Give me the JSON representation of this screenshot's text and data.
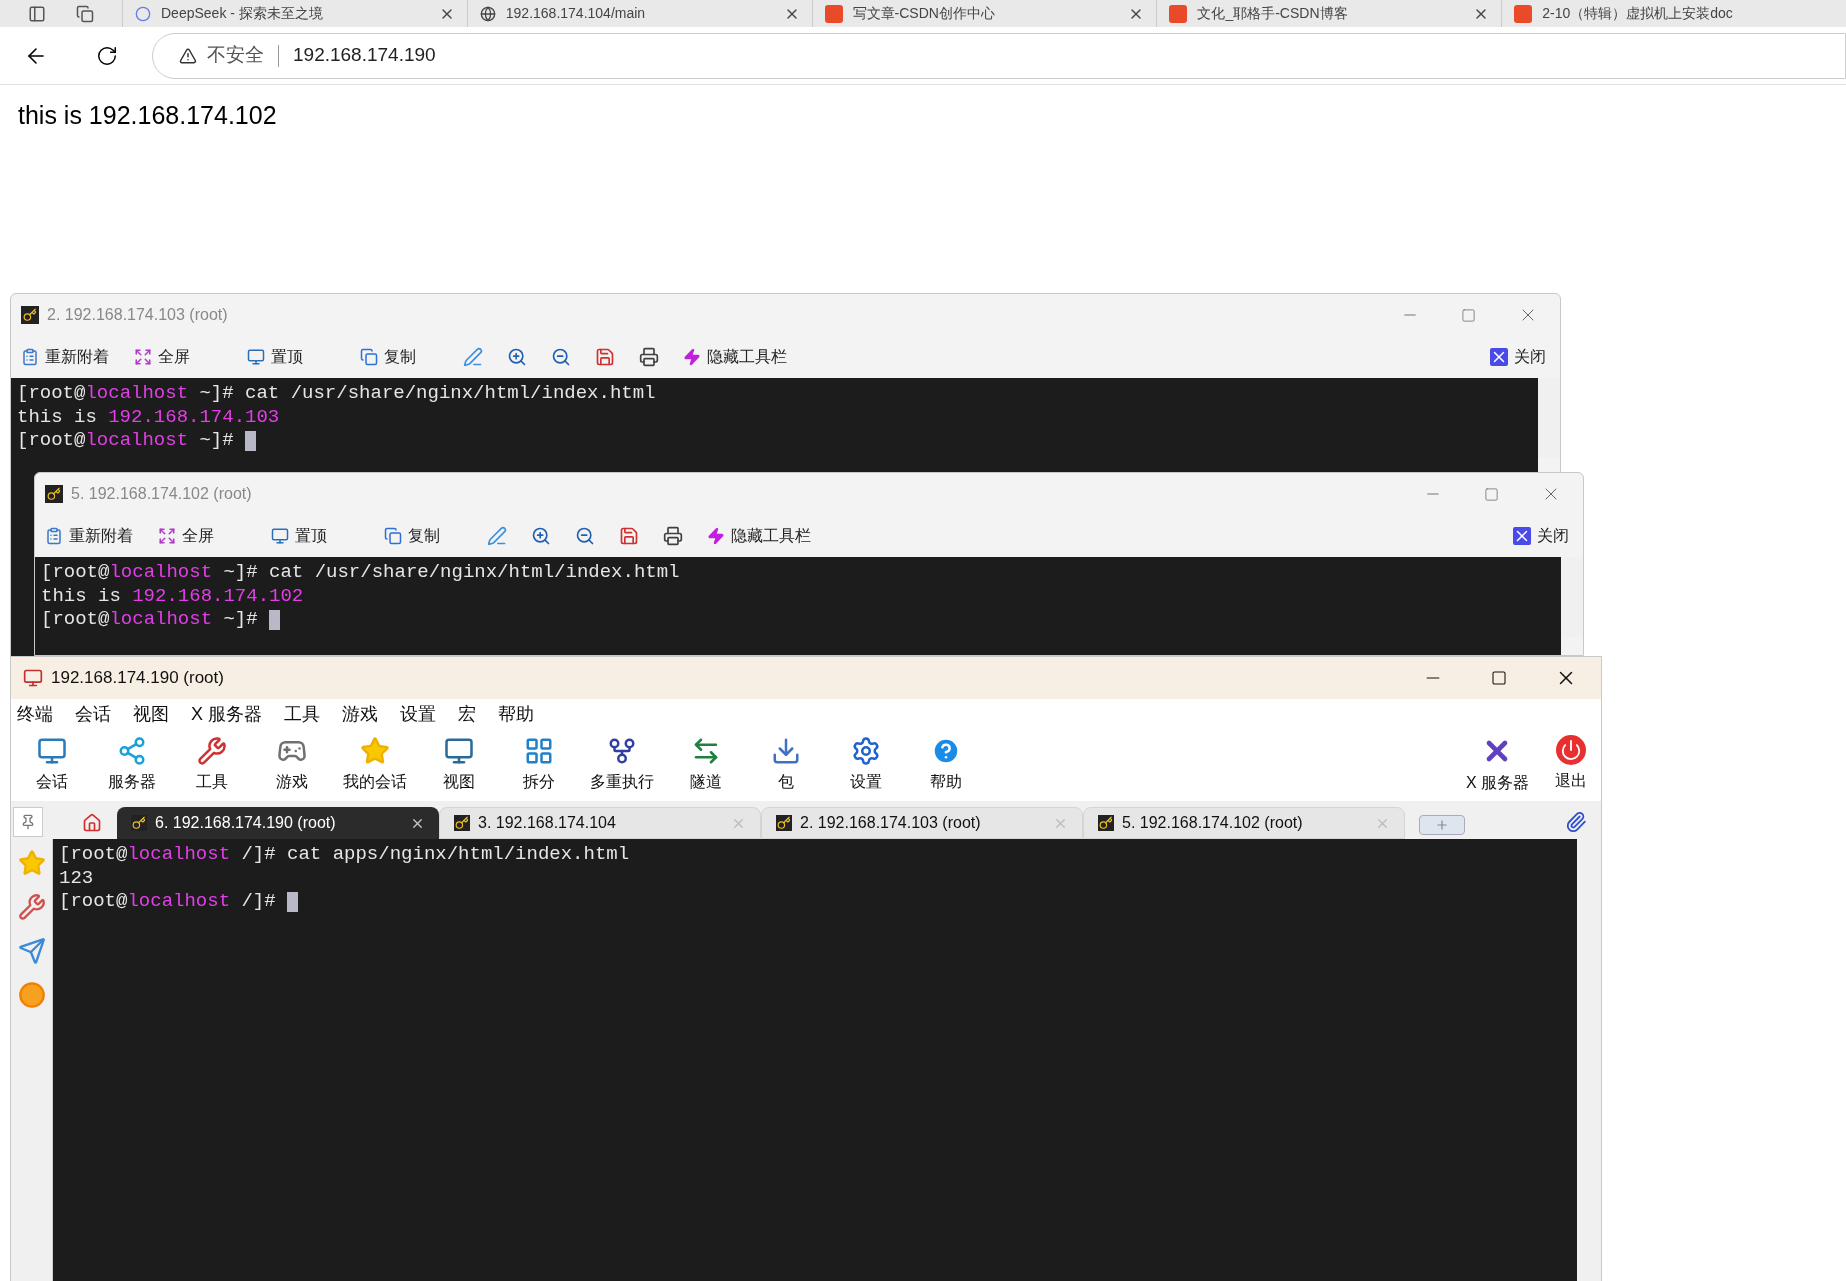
{
  "browser": {
    "tabs": [
      {
        "title": "DeepSeek - 探索未至之境",
        "selected": false
      },
      {
        "title": "192.168.174.104/main",
        "selected": false
      },
      {
        "title": "写文章-CSDN创作中心",
        "selected": false
      },
      {
        "title": "文化_耶格手-CSDN博客",
        "selected": false
      },
      {
        "title": "2-10（特辑）虚拟机上安装doc",
        "selected": false
      }
    ],
    "security": "不安全",
    "url": "192.168.174.190",
    "page_text": "this is 192.168.174.102"
  },
  "ssh_windows": [
    {
      "title": "2. 192.168.174.103 (root)",
      "toolbar": [
        "重新附着",
        "全屏",
        "置顶",
        "复制"
      ],
      "hide_toolbar": "隐藏工具栏",
      "close": "关闭",
      "lines": [
        {
          "segments": [
            {
              "text": "[root@",
              "kind": "plain"
            },
            {
              "text": "localhost",
              "kind": "accent"
            },
            {
              "text": " ~]# cat /usr/share/nginx/html/index.html",
              "kind": "plain"
            }
          ],
          "cursor": false
        },
        {
          "segments": [
            {
              "text": "this is ",
              "kind": "plain"
            },
            {
              "text": "192.168.174.103",
              "kind": "accent"
            }
          ],
          "cursor": false
        },
        {
          "segments": [
            {
              "text": "[root@",
              "kind": "plain"
            },
            {
              "text": "localhost",
              "kind": "accent"
            },
            {
              "text": " ~]# ",
              "kind": "plain"
            }
          ],
          "cursor": true
        }
      ]
    },
    {
      "title": "5. 192.168.174.102 (root)",
      "toolbar": [
        "重新附着",
        "全屏",
        "置顶",
        "复制"
      ],
      "hide_toolbar": "隐藏工具栏",
      "close": "关闭",
      "lines": [
        {
          "segments": [
            {
              "text": "[root@",
              "kind": "plain"
            },
            {
              "text": "localhost",
              "kind": "accent"
            },
            {
              "text": " ~]# cat /usr/share/nginx/html/index.html",
              "kind": "plain"
            }
          ],
          "cursor": false
        },
        {
          "segments": [
            {
              "text": "this is ",
              "kind": "plain"
            },
            {
              "text": "192.168.174.102",
              "kind": "accent"
            }
          ],
          "cursor": false
        },
        {
          "segments": [
            {
              "text": "[root@",
              "kind": "plain"
            },
            {
              "text": "localhost",
              "kind": "accent"
            },
            {
              "text": " ~]# ",
              "kind": "plain"
            }
          ],
          "cursor": true
        }
      ]
    }
  ],
  "main_window": {
    "title": "192.168.174.190 (root)",
    "menu": [
      "终端",
      "会话",
      "视图",
      "X 服务器",
      "工具",
      "游戏",
      "设置",
      "宏",
      "帮助"
    ],
    "toolbar": [
      {
        "label": "会话",
        "kind": "session"
      },
      {
        "label": "服务器",
        "kind": "servers"
      },
      {
        "label": "工具",
        "kind": "tools"
      },
      {
        "label": "游戏",
        "kind": "games"
      },
      {
        "label": "我的会话",
        "kind": "star"
      },
      {
        "label": "视图",
        "kind": "view"
      },
      {
        "label": "拆分",
        "kind": "split"
      },
      {
        "label": "多重执行",
        "kind": "multi"
      },
      {
        "label": "隧道",
        "kind": "tunnel"
      },
      {
        "label": "包",
        "kind": "package"
      },
      {
        "label": "设置",
        "kind": "settings"
      },
      {
        "label": "帮助",
        "kind": "help"
      }
    ],
    "toolbar_right": [
      {
        "label": "X 服务器",
        "kind": "xserver"
      },
      {
        "label": "退出",
        "kind": "exit"
      }
    ],
    "tabs": [
      {
        "label": "6. 192.168.174.190 (root)",
        "selected": true
      },
      {
        "label": "3. 192.168.174.104",
        "selected": false
      },
      {
        "label": "2. 192.168.174.103 (root)",
        "selected": false
      },
      {
        "label": "5. 192.168.174.102 (root)",
        "selected": false
      }
    ],
    "lines": [
      {
        "segments": [
          {
            "text": "[root@",
            "kind": "plain"
          },
          {
            "text": "localhost",
            "kind": "accent"
          },
          {
            "text": " /]# cat apps/nginx/html/index.html",
            "kind": "plain"
          }
        ],
        "cursor": false
      },
      {
        "segments": [
          {
            "text": "123",
            "kind": "plain"
          }
        ],
        "cursor": false
      },
      {
        "segments": [
          {
            "text": "[root@",
            "kind": "plain"
          },
          {
            "text": "localhost",
            "kind": "accent"
          },
          {
            "text": " /]# ",
            "kind": "plain"
          }
        ],
        "cursor": true
      }
    ]
  }
}
